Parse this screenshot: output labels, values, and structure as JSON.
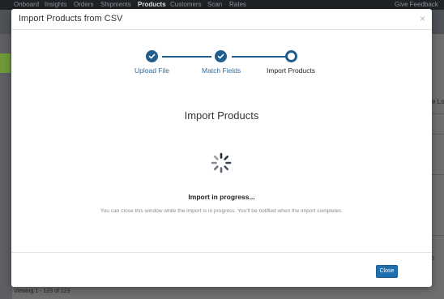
{
  "topnav": {
    "items": [
      "Onboard",
      "Insights",
      "Orders",
      "Shipments",
      "Products",
      "Customers",
      "Scan",
      "Rates"
    ],
    "active": "Products",
    "right_link": "Give Feedback"
  },
  "background": {
    "partial_column_text": "e Lo",
    "footer": "Viewing 1 - 123 of 123",
    "right_partial": "0"
  },
  "modal": {
    "title": "Import Products from CSV",
    "close_glyph": "×",
    "steps": [
      {
        "label": "Upload File",
        "state": "done"
      },
      {
        "label": "Match Fields",
        "state": "done"
      },
      {
        "label": "Import Products",
        "state": "current"
      }
    ],
    "section_title": "Import Products",
    "progress_heading": "Import in progress...",
    "progress_note": "You can close this window while the import is in progress. You'll be notified when the import completes.",
    "close_button": "Close"
  },
  "colors": {
    "accent": "#1f5d8c",
    "button": "#1f6fae",
    "nav_bg": "#1f2226"
  },
  "icons": {
    "step_done": "check-icon",
    "loading": "spinner-icon",
    "close": "close-icon"
  }
}
